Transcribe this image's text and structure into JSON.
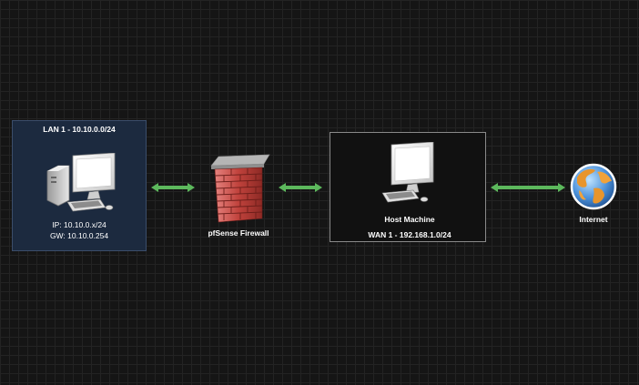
{
  "lan": {
    "title": "LAN 1 - 10.10.0.0/24",
    "ip": "IP: 10.10.0.x/24",
    "gw": "GW: 10.10.0.254"
  },
  "firewall": {
    "label": "pfSense Firewall"
  },
  "host": {
    "label": "Host Machine",
    "wan": "WAN 1 - 192.168.1.0/24"
  },
  "internet": {
    "label": "Internet"
  },
  "colors": {
    "arrow": "#5cb85c",
    "lan_fill": "#1c2a3f",
    "host_fill": "#111111",
    "background": "#151515"
  },
  "icons": [
    "computer-icon",
    "firewall-icon",
    "globe-icon",
    "double-arrow-icon"
  ]
}
